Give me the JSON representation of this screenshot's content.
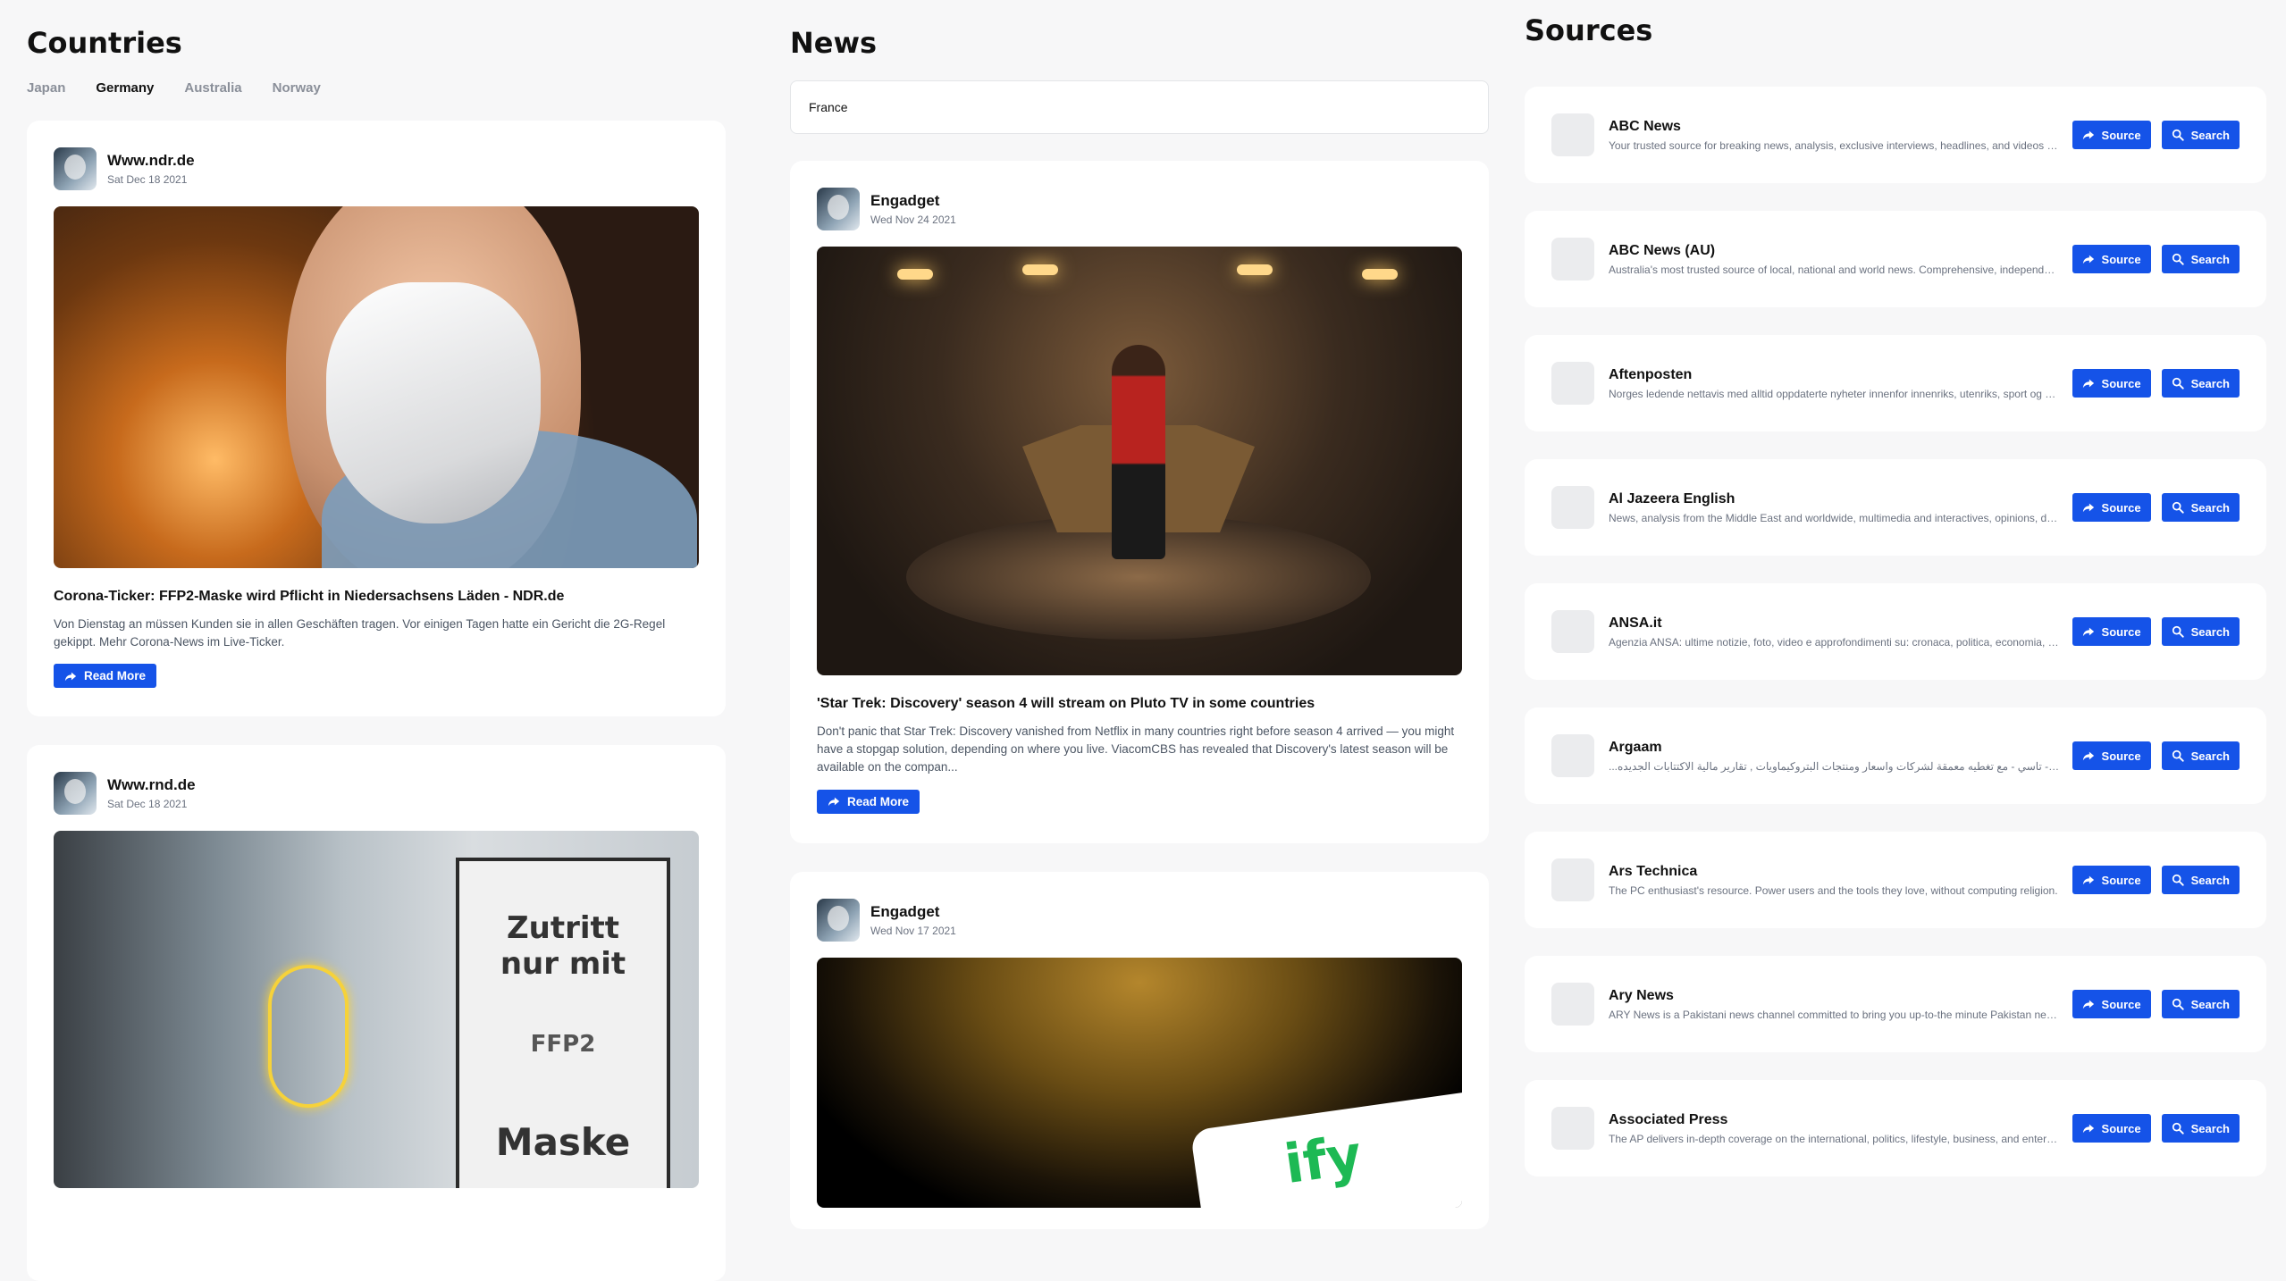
{
  "countries": {
    "heading": "Countries",
    "tabs": [
      "Japan",
      "Germany",
      "Australia",
      "Norway"
    ],
    "active_tab": "Germany",
    "posts": [
      {
        "source": "Www.ndr.de",
        "date": "Sat Dec 18 2021",
        "image": "person-wearing-ffp2-mask-photo",
        "title": "Corona-Ticker: FFP2-Maske wird Pflicht in Niedersachsens Läden - NDR.de",
        "description": "Von Dienstag an müssen Kunden sie in allen Geschäften tragen. Vor einigen Tagen hatte ein Gericht die 2G-Regel gekippt. Mehr Corona-News im Live-Ticker.",
        "button": "Read More"
      },
      {
        "source": "Www.rnd.de",
        "date": "Sat Dec 18 2021",
        "image": "shop-window-maske-sign-photo",
        "image_text": [
          "Zutritt",
          "nur mit",
          "FFP2",
          "Maske"
        ]
      }
    ]
  },
  "news": {
    "heading": "News",
    "search_value": "France",
    "posts": [
      {
        "source": "Engadget",
        "date": "Wed Nov 24 2021",
        "image": "star-trek-captain-chair-photo",
        "title": "'Star Trek: Discovery' season 4 will stream on Pluto TV in some countries",
        "description": "Don't panic that Star Trek: Discovery vanished from Netflix in many countries right before season 4 arrived — you might have a stopgap solution, depending on where you live. ViacomCBS has revealed that Discovery's latest season will be available on the compan...",
        "button": "Read More"
      },
      {
        "source": "Engadget",
        "date": "Wed Nov 17 2021",
        "image": "spotify-phone-photo",
        "image_text": "ify"
      }
    ]
  },
  "sources": {
    "heading": "Sources",
    "source_button": "Source",
    "search_button": "Search",
    "items": [
      {
        "name": "ABC News",
        "description": "Your trusted source for breaking news, analysis, exclusive interviews, headlines, and videos at ABCNews.com."
      },
      {
        "name": "ABC News (AU)",
        "description": "Australia's most trusted source of local, national and world news. Comprehensive, independent, in-depth analysis."
      },
      {
        "name": "Aftenposten",
        "description": "Norges ledende nettavis med alltid oppdaterte nyheter innenfor innenriks, utenriks, sport og kultur."
      },
      {
        "name": "Al Jazeera English",
        "description": "News, analysis from the Middle East and worldwide, multimedia and interactives, opinions, documentaries."
      },
      {
        "name": "ANSA.it",
        "description": "Agenzia ANSA: ultime notizie, foto, video e approfondimenti su: cronaca, politica, economia, regioni."
      },
      {
        "name": "Argaam",
        "description": "...اول - تاسي - مع تغطيه معمقة لشركات واسعار ومنتجات البتروكيماويات , تقارير مالية الاكتتابات الجديده"
      },
      {
        "name": "Ars Technica",
        "description": "The PC enthusiast's resource. Power users and the tools they love, without computing religion."
      },
      {
        "name": "Ary News",
        "description": "ARY News is a Pakistani news channel committed to bring you up-to-the minute Pakistan news and featured stories."
      },
      {
        "name": "Associated Press",
        "description": "The AP delivers in-depth coverage on the international, politics, lifestyle, business, and entertainment news."
      }
    ]
  }
}
